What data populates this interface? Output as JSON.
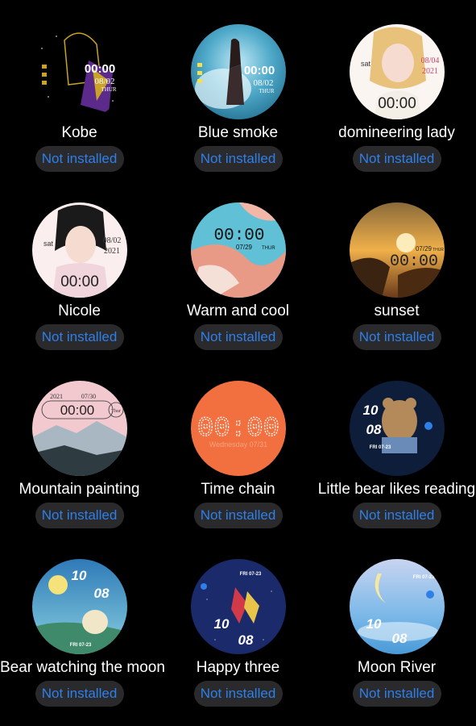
{
  "status_label": "Not installed",
  "faces": [
    {
      "name": "Kobe",
      "time": "00:00",
      "date": "08/02",
      "day": "THUR"
    },
    {
      "name": "Blue smoke",
      "time": "00:00",
      "date": "08/02",
      "day": "THUR"
    },
    {
      "name": "domineering lady",
      "time": "00:00",
      "date": "08/04",
      "year": "2021",
      "weekday": "sat"
    },
    {
      "name": "Nicole",
      "time": "00:00",
      "date": "08/02",
      "year": "2021",
      "weekday": "sat"
    },
    {
      "name": "Warm and cool",
      "time": "00:00",
      "date": "07/29",
      "day": "THUR"
    },
    {
      "name": "sunset",
      "time": "00:00",
      "date": "07/29",
      "day": "THUR"
    },
    {
      "name": "Mountain painting",
      "time": "00:00",
      "year": "2021",
      "date": "07/30",
      "day": "Thur"
    },
    {
      "name": "Time chain",
      "time": "00:00",
      "date": "Wednesday 07/31"
    },
    {
      "name": "Little bear likes reading",
      "hour": "10",
      "minute": "08",
      "date": "FRI 07-23"
    },
    {
      "name": "Bear watching the moon",
      "hour": "10",
      "minute": "08",
      "date": "FRI 07-23"
    },
    {
      "name": "Happy three",
      "hour": "10",
      "minute": "08",
      "date": "FRI 07-23"
    },
    {
      "name": "Moon River",
      "hour": "10",
      "minute": "08",
      "date": "FRI 07-23"
    }
  ],
  "colors": {
    "background": "#000000",
    "status_bg": "#2a2a2c",
    "status_text": "#2f7fe9",
    "label": "#ffffff"
  }
}
